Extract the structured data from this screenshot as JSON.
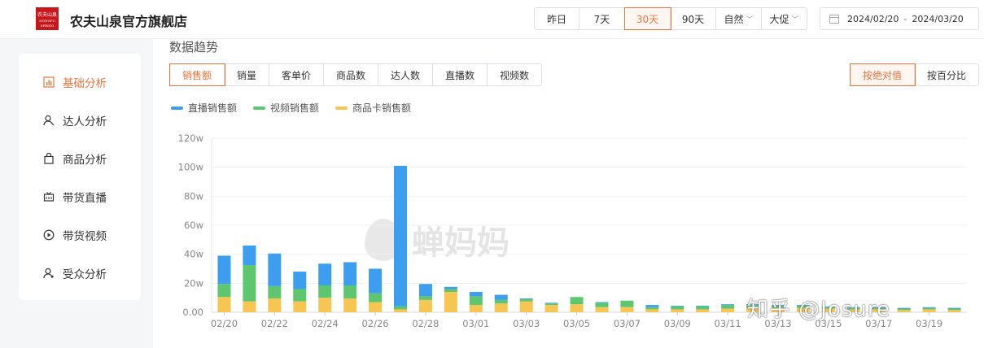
{
  "header": {
    "logo_text_line1": "农夫山泉",
    "logo_text_line2": "NONGFU SPRING",
    "store_name": "农夫山泉官方旗舰店",
    "ranges": [
      "昨日",
      "7天",
      "30天",
      "90天",
      "自然",
      "大促"
    ],
    "active_range": "30天",
    "date_start": "2024/02/20",
    "date_sep": "-",
    "date_end": "2024/03/20"
  },
  "sidebar": {
    "items": [
      {
        "label": "基础分析",
        "icon": "bar-chart-icon",
        "active": true
      },
      {
        "label": "达人分析",
        "icon": "user-icon",
        "active": false
      },
      {
        "label": "商品分析",
        "icon": "shopping-bag-icon",
        "active": false
      },
      {
        "label": "带货直播",
        "icon": "live-tv-icon",
        "active": false
      },
      {
        "label": "带货视频",
        "icon": "play-circle-icon",
        "active": false
      },
      {
        "label": "受众分析",
        "icon": "audience-icon",
        "active": false
      }
    ]
  },
  "main": {
    "section_title": "数据趋势",
    "tabs": [
      "销售额",
      "销量",
      "客单价",
      "商品数",
      "达人数",
      "直播数",
      "视频数"
    ],
    "active_tab": "销售额",
    "modes": [
      "按绝对值",
      "按百分比"
    ],
    "active_mode": "按绝对值",
    "watermark": "蝉妈妈",
    "credit": "知乎 @Josure"
  },
  "colors": {
    "accent": "#e8743b",
    "live": "#3d9ef0",
    "video": "#5ec66f",
    "card": "#f7c551"
  },
  "chart_data": {
    "type": "bar",
    "stacked": true,
    "ylim": [
      0,
      120
    ],
    "yticks": [
      "0.00",
      "20w",
      "40w",
      "60w",
      "80w",
      "100w",
      "120w"
    ],
    "categories": [
      "02/20",
      "02/21",
      "02/22",
      "02/23",
      "02/24",
      "02/25",
      "02/26",
      "02/27",
      "02/28",
      "02/29",
      "03/01",
      "03/02",
      "03/03",
      "03/04",
      "03/05",
      "03/06",
      "03/07",
      "03/08",
      "03/09",
      "03/10",
      "03/11",
      "03/12",
      "03/13",
      "03/14",
      "03/15",
      "03/16",
      "03/17",
      "03/18",
      "03/19",
      "03/20"
    ],
    "x_tick_labels": [
      "02/20",
      "02/22",
      "02/24",
      "02/26",
      "02/28",
      "03/01",
      "03/03",
      "03/05",
      "03/07",
      "03/09",
      "03/11",
      "03/13",
      "03/15",
      "03/17",
      "03/19"
    ],
    "series": [
      {
        "name": "商品卡销售额",
        "values": [
          10.5,
          7.5,
          9.5,
          7.5,
          10,
          9.5,
          7,
          2,
          8.5,
          14,
          5,
          6,
          7.5,
          5,
          5.5,
          3.5,
          3.5,
          2,
          2,
          2,
          2.5,
          3,
          3,
          3,
          2.5,
          2,
          2,
          1.5,
          2,
          1.5
        ]
      },
      {
        "name": "视频销售额",
        "values": [
          9,
          25,
          8.5,
          8.5,
          8.5,
          9,
          6,
          2,
          2.5,
          2,
          6,
          2.5,
          1.5,
          1,
          5,
          3,
          4.5,
          1.5,
          2,
          2,
          2.5,
          2,
          1.5,
          1.5,
          1,
          1,
          1,
          1,
          1,
          1
        ]
      },
      {
        "name": "直播销售额",
        "values": [
          19.5,
          13.5,
          22.5,
          12,
          15,
          16,
          17,
          97,
          8.5,
          1.5,
          3,
          3.5,
          0.5,
          0.5,
          0,
          0.5,
          0,
          1.5,
          0.5,
          0.5,
          0.5,
          0.5,
          0.5,
          0.5,
          0.5,
          0.5,
          0.5,
          0.5,
          0.5,
          0.5
        ]
      }
    ]
  }
}
